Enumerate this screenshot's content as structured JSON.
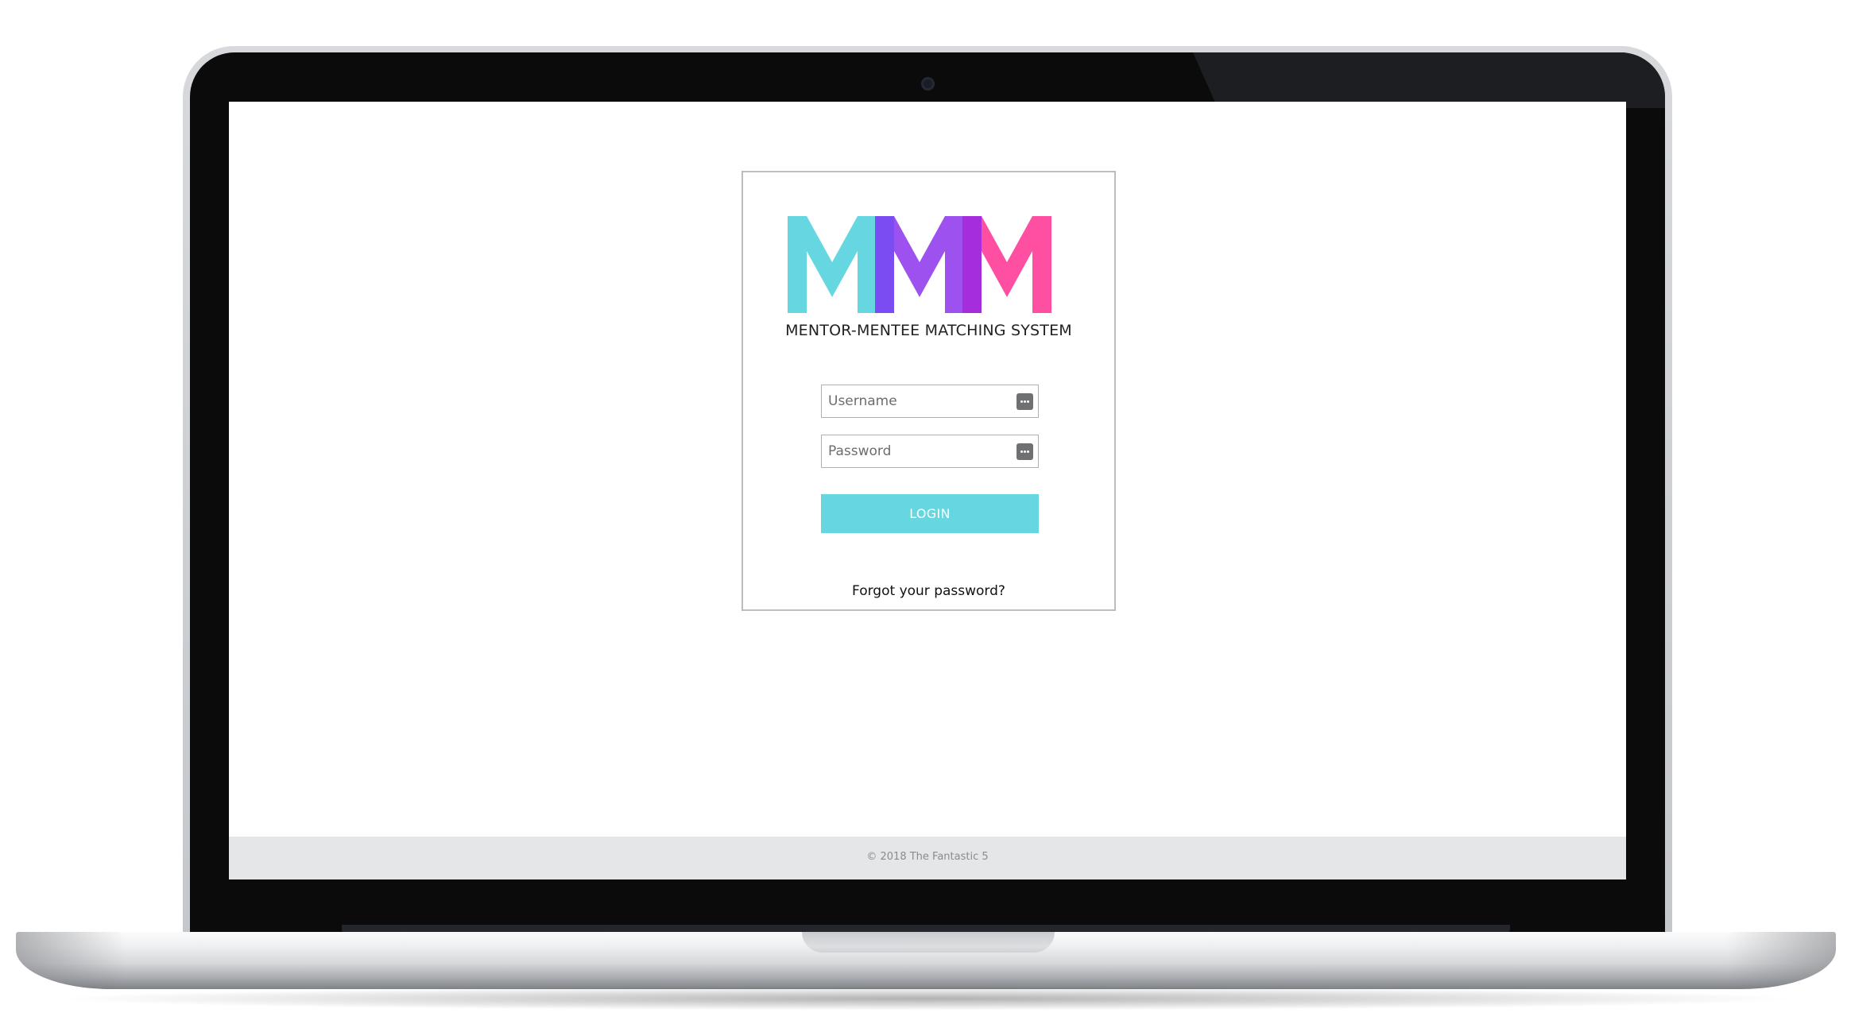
{
  "app": {
    "logo_text": "MMM",
    "tagline": "MENTOR-MENTEE MATCHING SYSTEM",
    "colors": {
      "m1": "#66d6e1",
      "m2a": "#7b4cf2",
      "m2b": "#9d52f0",
      "m3a": "#a62ddc",
      "m3b": "#ff4fa2",
      "button": "#66d6e1"
    }
  },
  "login": {
    "username_placeholder": "Username",
    "username_value": "",
    "password_placeholder": "Password",
    "password_value": "",
    "field_icon": "password-manager-icon",
    "login_label": "LOGIN",
    "forgot_label": "Forgot your password?"
  },
  "footer": {
    "copyright": "© 2018 The Fantastic 5"
  }
}
